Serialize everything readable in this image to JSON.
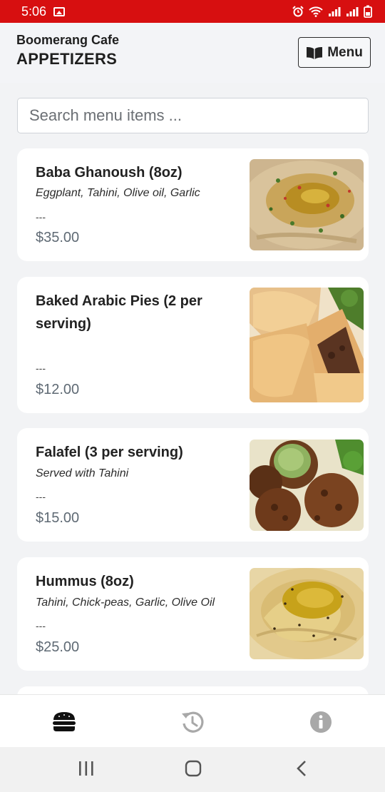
{
  "status_bar": {
    "time": "5:06"
  },
  "header": {
    "cafe_name": "Boomerang Cafe",
    "section_title": "APPETIZERS",
    "menu_button_label": "Menu"
  },
  "search": {
    "placeholder": "Search menu items ..."
  },
  "items": [
    {
      "name": "Baba Ghanoush (8oz)",
      "description": "Eggplant, Tahini, Olive oil, Garlic",
      "separator": "---",
      "price": "$35.00",
      "image": "baba-ghanoush-photo"
    },
    {
      "name": "Baked Arabic Pies (2 per serving)",
      "description": "",
      "separator": "---",
      "price": "$12.00",
      "image": "arabic-pies-photo"
    },
    {
      "name": "Falafel (3 per serving)",
      "description": "Served with Tahini",
      "separator": "---",
      "price": "$15.00",
      "image": "falafel-photo"
    },
    {
      "name": "Hummus (8oz)",
      "description": "Tahini, Chick-peas, Garlic, Olive Oil",
      "separator": "---",
      "price": "$25.00",
      "image": "hummus-photo"
    }
  ],
  "bottom_nav": [
    {
      "icon": "burger-icon",
      "active": true
    },
    {
      "icon": "history-icon",
      "active": false
    },
    {
      "icon": "info-icon",
      "active": false
    }
  ],
  "colors": {
    "status_bar": "#d70f10",
    "price": "#5f6a74",
    "nav_active": "#111111",
    "nav_inactive": "#a8a8a8"
  }
}
